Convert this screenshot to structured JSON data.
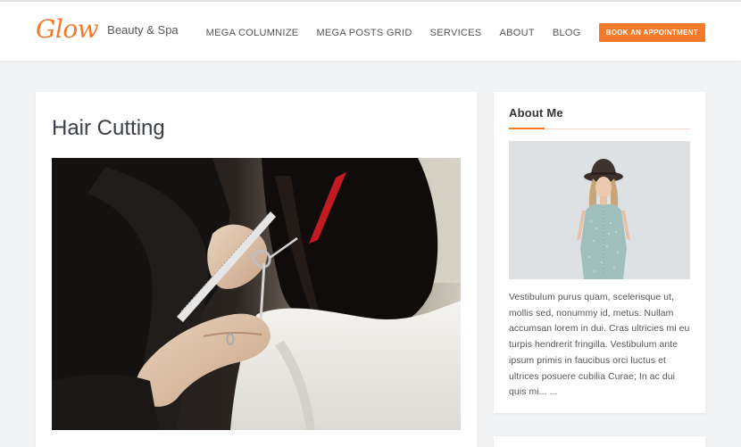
{
  "site": {
    "logo_text": "Glow",
    "tagline": "Beauty & Spa"
  },
  "nav": {
    "items": [
      {
        "label": "MEGA COLUMNIZE"
      },
      {
        "label": "MEGA POSTS GRID"
      },
      {
        "label": "SERVICES"
      },
      {
        "label": "ABOUT"
      },
      {
        "label": "BLOG"
      }
    ],
    "cta_label": "BOOK AN APPOINTMENT"
  },
  "post": {
    "title": "Hair Cutting"
  },
  "sidebar": {
    "about_title": "About Me",
    "about_text": "Vestibulum purus quam, scelerisque ut, mollis sed, nonummy id, metus. Nullam accumsan lorem in dui. Cras ultricies mi eu turpis hendrerit fringilla. Vestibulum ante ipsum primis in faucibus orci luctus et ultrices posuere cubilia Curae; In ac dui quis mi... ..."
  },
  "colors": {
    "accent": "#f37a2b",
    "background": "#f1f2f4",
    "card": "#ffffff"
  }
}
